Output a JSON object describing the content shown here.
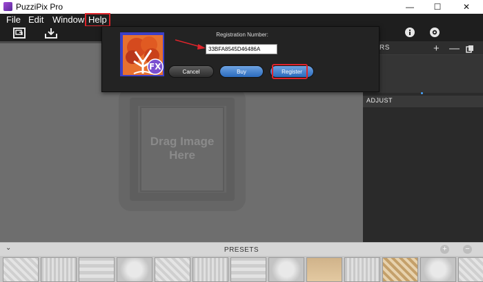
{
  "window": {
    "title": "PuzziPix Pro",
    "minimize_glyph": "—",
    "maximize_glyph": "☐",
    "close_glyph": "✕"
  },
  "menu": {
    "items": [
      {
        "label": "File"
      },
      {
        "label": "Edit"
      },
      {
        "label": "Window"
      },
      {
        "label": "Help"
      }
    ]
  },
  "toolbar": {
    "icons": [
      "frame-icon",
      "import-tray-icon",
      "info-icon",
      "settings-icon"
    ]
  },
  "canvas": {
    "drop_hint_line1": "Drag Image",
    "drop_hint_line2": "Here"
  },
  "right_panel": {
    "layers_label": "RS",
    "add_glyph": "+",
    "remove_glyph": "—",
    "adjust_label": "ADJUST"
  },
  "registration_dialog": {
    "label": "Registration Number:",
    "value": "33BFA8545D46486A",
    "cancel_label": "Cancel",
    "buy_label": "Buy",
    "register_label": "Register",
    "logo_text": "FX"
  },
  "presets": {
    "label": "PRESETS",
    "toggle_glyph": "⌄",
    "add_glyph": "+",
    "remove_glyph": "−",
    "thumbnail_count": 13
  },
  "colors": {
    "highlight": "#e0242b",
    "accent_blue": "#2b6bbd"
  }
}
